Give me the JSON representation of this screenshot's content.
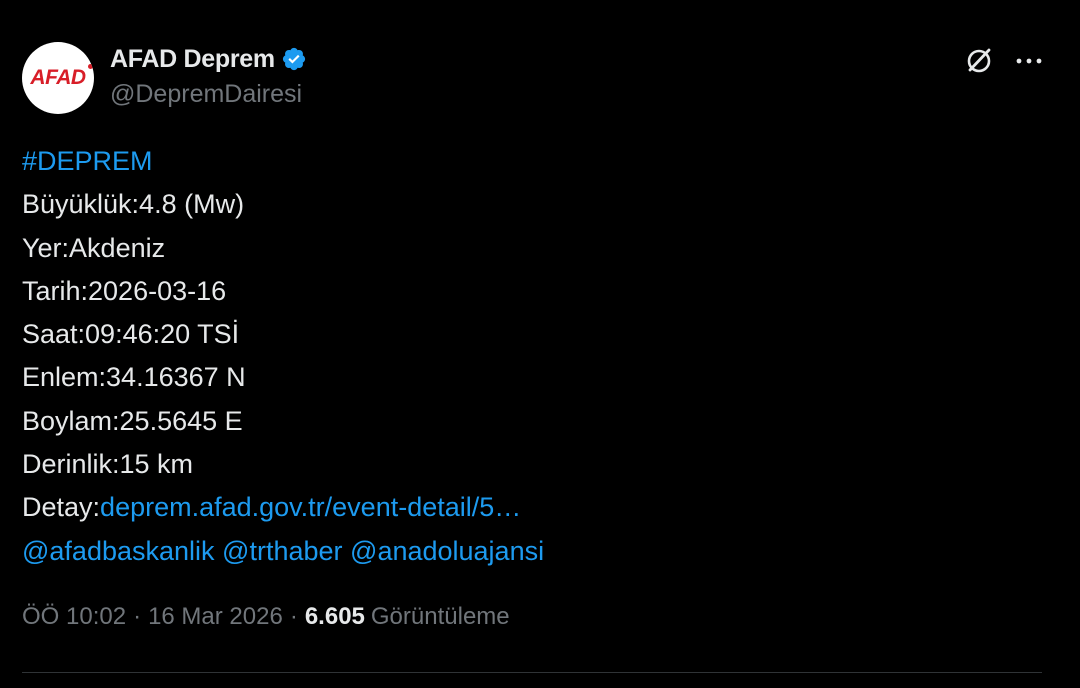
{
  "author": {
    "display_name": "AFAD Deprem",
    "handle": "@DepremDairesi",
    "avatar_text": "AFAD",
    "verified": true
  },
  "tweet": {
    "hashtag": "#DEPREM",
    "magnitude": "Büyüklük:4.8 (Mw)",
    "location": "Yer:Akdeniz",
    "date": "Tarih:2026-03-16",
    "time": "Saat:09:46:20 TSİ",
    "latitude": "Enlem:34.16367 N",
    "longitude": "Boylam:25.5645 E",
    "depth": "Derinlik:15 km",
    "detail_label": "Detay:",
    "detail_link": "deprem.afad.gov.tr/event-detail/5…",
    "mentions": [
      "@afadbaskanlik",
      "@trthaber",
      "@anadoluajansi"
    ]
  },
  "meta": {
    "time": "ÖÖ 10:02",
    "date": "16 Mar 2026",
    "separator": "·",
    "views_count": "6.605",
    "views_label": "Görüntüleme"
  },
  "icons": {
    "grok": "grok-icon",
    "more": "more-icon",
    "verified": "verified-badge-icon"
  },
  "colors": {
    "background": "#000000",
    "text": "#e7e9ea",
    "secondary": "#71767b",
    "link": "#1d9bf0",
    "avatar_brand": "#d81e28"
  }
}
